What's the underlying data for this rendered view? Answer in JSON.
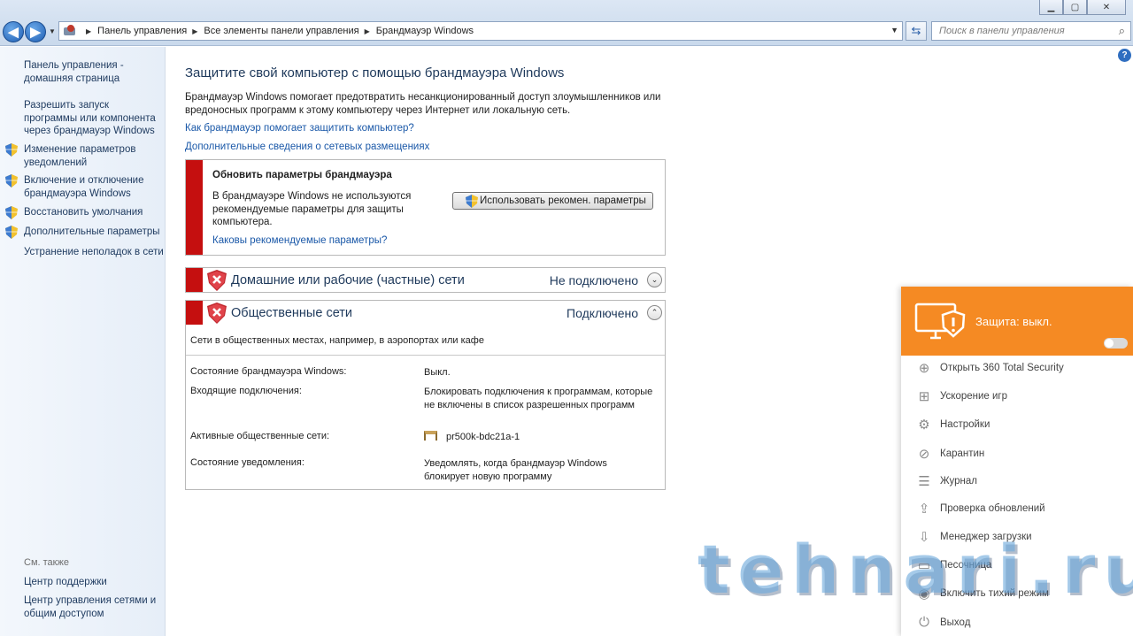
{
  "window": {
    "minimize": "▁",
    "maximize": "▢",
    "close": "✕"
  },
  "nav": {
    "back": "◀",
    "forward": "▶"
  },
  "address": {
    "crumbs": [
      "Панель управления",
      "Все элементы панели управления",
      "Брандмауэр Windows"
    ],
    "search_placeholder": "Поиск в панели управления"
  },
  "sidebar": {
    "home": "Панель управления - домашняя страница",
    "links": [
      "Разрешить запуск программы или компонента через брандмауэр Windows",
      "Изменение параметров уведомлений",
      "Включение и отключение брандмауэра Windows",
      "Восстановить умолчания",
      "Дополнительные параметры",
      "Устранение неполадок в сети"
    ],
    "see_also": "См. также",
    "bottom_links": [
      "Центр поддержки",
      "Центр управления сетями и общим доступом"
    ]
  },
  "main": {
    "title": "Защитите свой компьютер с помощью брандмауэра Windows",
    "intro": "Брандмауэр Windows помогает предотвратить несанкционированный доступ злоумышленников или вредоносных программ к этому компьютеру через Интернет или локальную сеть.",
    "link_how": "Как брандмауэр помогает защитить компьютер?",
    "link_more": "Дополнительные сведения о сетевых размещениях"
  },
  "warning": {
    "title": "Обновить параметры брандмауэра",
    "text": "В брандмауэре Windows не используются рекомендуемые параметры для защиты компьютера.",
    "button": "Использовать рекомен. параметры",
    "link": "Каковы рекомендуемые параметры?"
  },
  "networks": {
    "private": {
      "name": "Домашние или рабочие (частные) сети",
      "status": "Не подключено",
      "chevron": "⌄"
    },
    "public": {
      "name": "Общественные сети",
      "status": "Подключено",
      "chevron": "⌃"
    },
    "public_desc": "Сети в общественных местах, например, в аэропортах или кафе",
    "rows": [
      {
        "label": "Состояние брандмауэра Windows:",
        "value": "Выкл."
      },
      {
        "label": "Входящие подключения:",
        "value": "Блокировать подключения к программам, которые не включены в список разрешенных программ"
      },
      {
        "label": "Активные общественные сети:",
        "value": "pr500k-bdc21a-1"
      },
      {
        "label": "Состояние уведомления:",
        "value": "Уведомлять, когда брандмауэр Windows блокирует новую программу"
      }
    ]
  },
  "security360": {
    "title": "Защита: выкл.",
    "protection_on": false,
    "accent": "#f58a23",
    "items": [
      {
        "label": "Открыть 360 Total Security",
        "icon": "plus-circle-icon"
      },
      {
        "label": "Ускорение игр",
        "icon": "gamepad-icon"
      },
      {
        "label": "Настройки",
        "icon": "gear-icon"
      },
      {
        "label": "Карантин",
        "icon": "block-icon"
      },
      {
        "label": "Журнал",
        "icon": "document-icon"
      },
      {
        "label": "Проверка обновлений",
        "icon": "update-icon"
      },
      {
        "label": "Менеджер загрузки",
        "icon": "download-icon"
      },
      {
        "label": "Песочница",
        "icon": "sandbox-icon"
      },
      {
        "label": "Включить тихий режим",
        "icon": "silent-icon"
      },
      {
        "label": "Выход",
        "icon": "power-icon"
      }
    ]
  },
  "watermark": "tehnari.ru",
  "colors": {
    "alert_red": "#c50f0f",
    "link_blue": "#1a58a8",
    "title_blue": "#1e395b"
  }
}
